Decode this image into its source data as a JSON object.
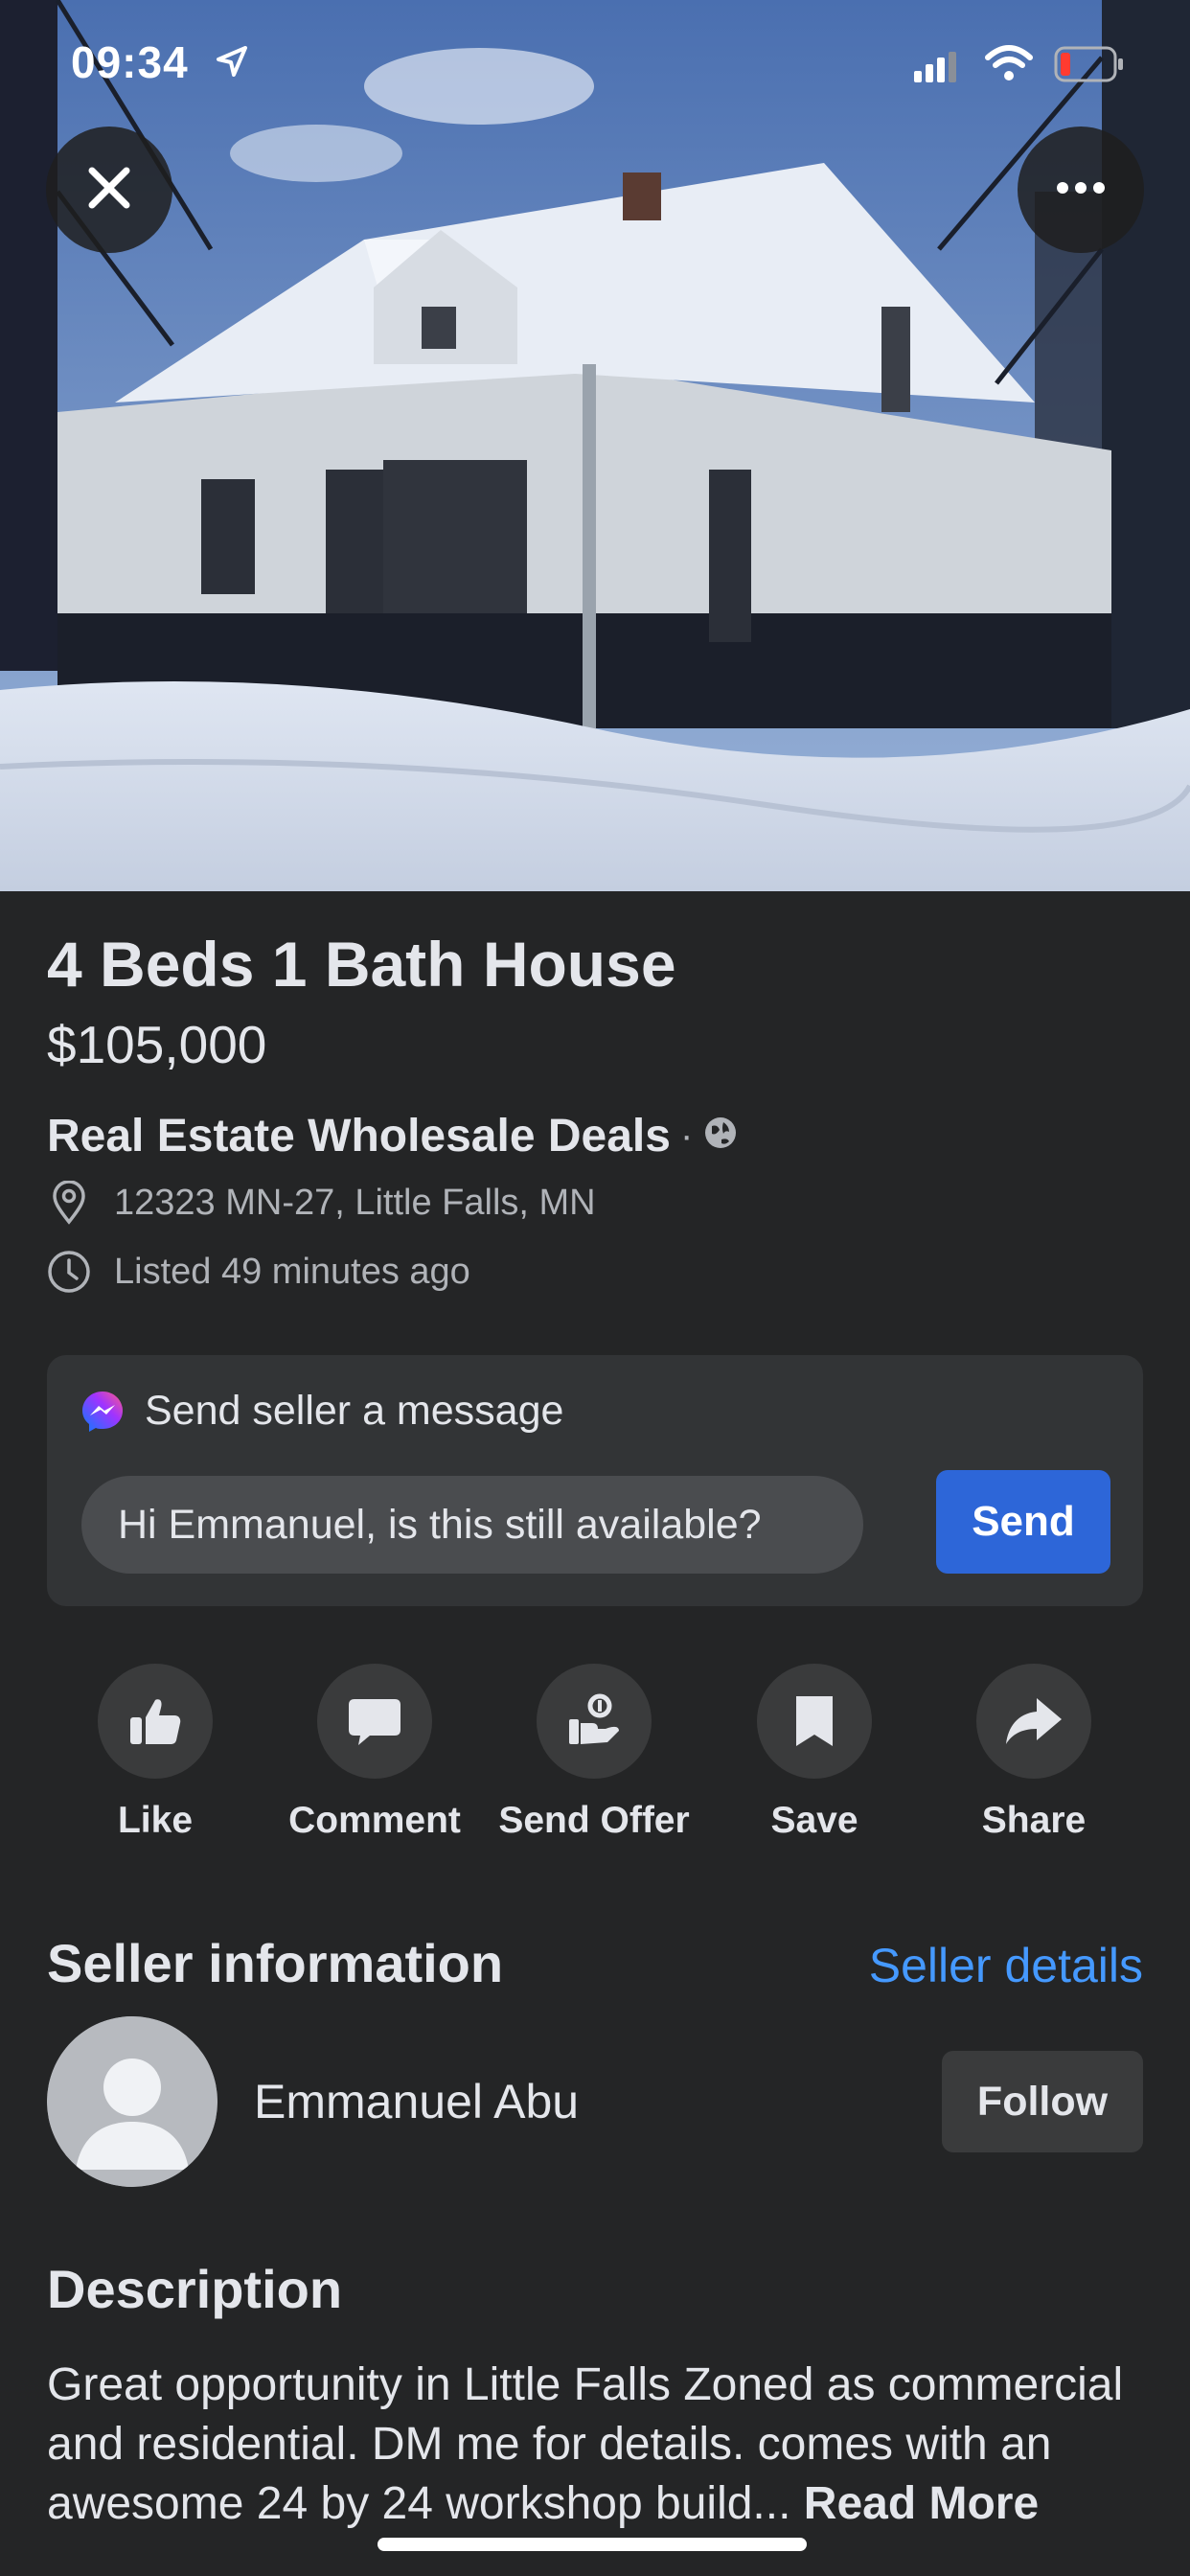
{
  "status_bar": {
    "time": "09:34"
  },
  "listing": {
    "title": "4 Beds 1 Bath House",
    "price": "$105,000",
    "group_name": "Real Estate Wholesale Deals",
    "separator": "·",
    "location": "12323 MN-27, Little Falls, MN",
    "listed": "Listed 49 minutes ago"
  },
  "message": {
    "header": "Send seller a message",
    "input_value": "Hi Emmanuel, is this still available?",
    "send_label": "Send"
  },
  "actions": [
    {
      "label": "Like",
      "icon": "thumbs-up-icon"
    },
    {
      "label": "Comment",
      "icon": "comment-icon"
    },
    {
      "label": "Send Offer",
      "icon": "offer-hand-icon"
    },
    {
      "label": "Save",
      "icon": "bookmark-icon"
    },
    {
      "label": "Share",
      "icon": "share-arrow-icon"
    }
  ],
  "seller": {
    "section_title": "Seller information",
    "details_link": "Seller details",
    "name": "Emmanuel Abu",
    "follow_label": "Follow"
  },
  "description": {
    "title": "Description",
    "text": "Great opportunity in Little Falls Zoned as commercial and residential. DM me for details. comes with an awesome 24 by 24 workshop build...",
    "read_more": "Read More"
  },
  "colors": {
    "background": "#242526",
    "accent_button": "#2d66d8",
    "link": "#4599ff"
  }
}
